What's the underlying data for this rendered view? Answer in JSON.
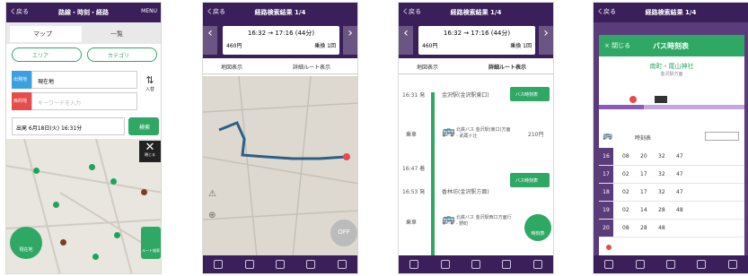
{
  "screen1": {
    "back": "く戻る",
    "title": "路線・時刻・経路",
    "menu": "MENU",
    "tab_map": "マップ",
    "tab_list": "一覧",
    "area_btn": "エリア",
    "category_btn": "カテゴリ",
    "origin_label": "出発地",
    "origin_value": "現在地",
    "dest_label": "目的地",
    "dest_placeholder": "キーワードを入力",
    "swap_label": "入替",
    "datetime": "出発 6月18日(火) 16:31分",
    "search_btn": "検索",
    "close_label": "閉じる",
    "locate_label": "現在地",
    "route_label": "ルート検索"
  },
  "screen2": {
    "back": "く戻る",
    "title": "経路検索結果 1/4",
    "times": "16:32 → 17:16 (44分)",
    "fare": "460円",
    "transfer": "乗換 1回",
    "tab_map": "地図表示",
    "tab_detail": "詳細ルート表示",
    "off_label": "OFF"
  },
  "screen3": {
    "back": "く戻る",
    "title": "経路検索結果 1/4",
    "times": "16:32 → 17:16 (44分)",
    "fare": "460円",
    "transfer": "乗換 1回",
    "tab_map": "地図表示",
    "tab_detail": "詳細ルート表示",
    "stop1_time": "16:31 発",
    "stop1_name": "金沢駅(金沢駅東口)",
    "stop1_btn": "バス時刻表",
    "ride1_label": "乗車",
    "ride1_desc": "北鉄バス 金沢駅(東口)方面 - 武蔵ヶ辻",
    "ride1_fare": "210円",
    "stop2_time": "16:47 着",
    "stop2_time_b": "16:53 発",
    "stop2_name": "香林坊(金沢駅方面)",
    "stop2_btn": "バス時刻表",
    "ride2_label": "乗車",
    "ride2_desc": "北鉄バス 金沢駅西口方面行 - 野町",
    "ride2_btn": "時刻表"
  },
  "screen4": {
    "back": "く戻る",
    "title": "経路検索結果 1/4",
    "close_label": "× 閉じる",
    "panel_title": "バス時刻表",
    "stop_name": "南町・尾山神社",
    "stop_sub": "金沢駅方面",
    "table_header": "時刻表",
    "rows": [
      {
        "hour": "16",
        "mins": [
          "08",
          "20",
          "32",
          "47"
        ]
      },
      {
        "hour": "17",
        "mins": [
          "02",
          "17",
          "32",
          "47"
        ]
      },
      {
        "hour": "18",
        "mins": [
          "02",
          "17",
          "32",
          "47"
        ]
      },
      {
        "hour": "19",
        "mins": [
          "02",
          "14",
          "28",
          "48"
        ]
      },
      {
        "hour": "20",
        "mins": [
          "08",
          "28",
          "48",
          ""
        ]
      }
    ]
  }
}
